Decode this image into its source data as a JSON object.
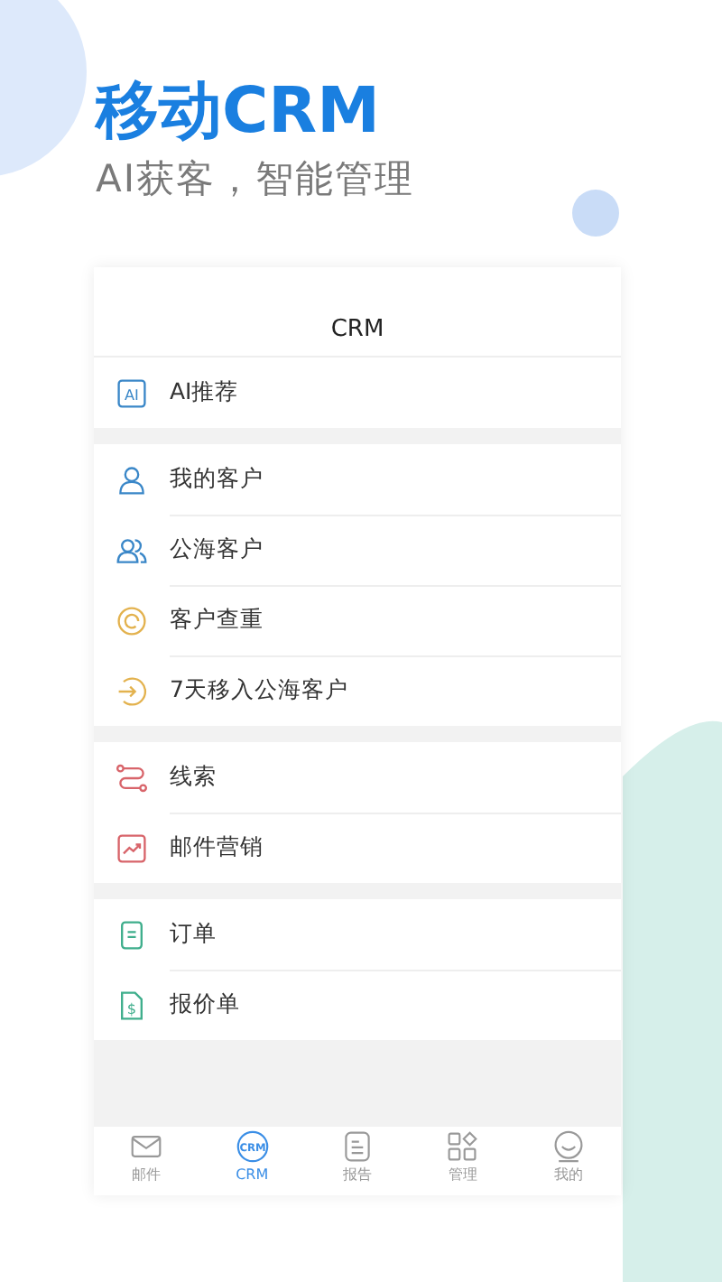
{
  "headline": {
    "title": "移动CRM",
    "subtitle": "AI获客，智能管理"
  },
  "app": {
    "title": "CRM",
    "groups": [
      {
        "items": [
          {
            "kind": "ai",
            "label": "AI推荐",
            "icon_text": "AI"
          }
        ]
      },
      {
        "items": [
          {
            "kind": "person",
            "label": "我的客户"
          },
          {
            "kind": "people",
            "label": "公海客户"
          },
          {
            "kind": "at",
            "label": "客户查重"
          },
          {
            "kind": "enter",
            "label": "7天移入公海客户"
          }
        ]
      },
      {
        "items": [
          {
            "kind": "route",
            "label": "线索"
          },
          {
            "kind": "chart",
            "label": "邮件营销"
          }
        ]
      },
      {
        "items": [
          {
            "kind": "doc",
            "label": "订单"
          },
          {
            "kind": "quote",
            "label": "报价单",
            "icon_text": "$"
          }
        ]
      }
    ],
    "tabs": [
      {
        "kind": "mail",
        "label": "邮件",
        "selected": false
      },
      {
        "kind": "crm",
        "label": "CRM",
        "icon_text": "CRM",
        "selected": true
      },
      {
        "kind": "report",
        "label": "报告",
        "selected": false
      },
      {
        "kind": "grid",
        "label": "管理",
        "selected": false
      },
      {
        "kind": "face",
        "label": "我的",
        "selected": false
      }
    ]
  }
}
